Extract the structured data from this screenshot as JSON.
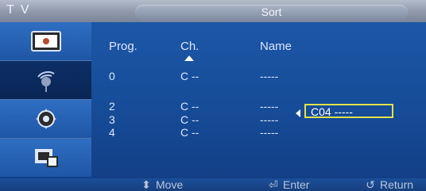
{
  "header": {
    "source_label": "T V",
    "title": "Sort"
  },
  "sidebar": {
    "items": [
      {
        "icon": "picture-icon"
      },
      {
        "icon": "antenna-icon"
      },
      {
        "icon": "gear-icon"
      },
      {
        "icon": "input-icon"
      }
    ],
    "active_index": 1
  },
  "table": {
    "headers": {
      "prog": "Prog.",
      "ch": "Ch.",
      "name": "Name"
    },
    "rows": [
      {
        "prog": "0",
        "ch": "C --",
        "name": "-----"
      },
      {
        "prog": "2",
        "ch": "C --",
        "name": "-----"
      },
      {
        "prog": "3",
        "ch": "C --",
        "name": "-----"
      },
      {
        "prog": "4",
        "ch": "C --",
        "name": "-----"
      }
    ],
    "edit_value": "C04 -----"
  },
  "footer": {
    "move": "Move",
    "enter": "Enter",
    "return": "Return"
  },
  "colors": {
    "highlight_border": "#e2e24a",
    "background": "#164c98"
  }
}
